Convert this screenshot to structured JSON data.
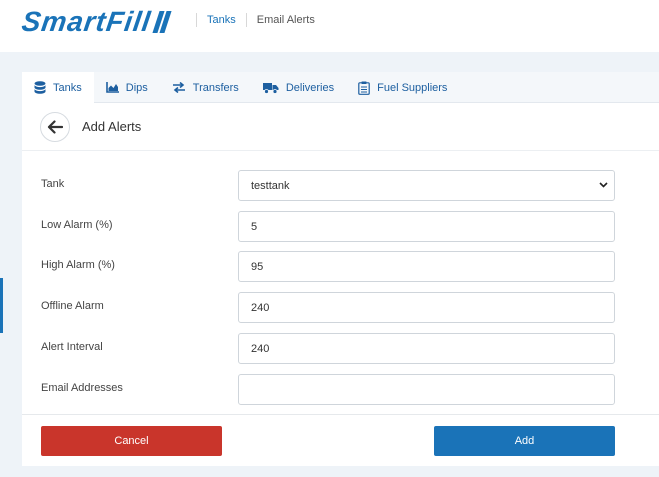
{
  "brand": {
    "name": "SmartFill",
    "color": "#1a73b8"
  },
  "breadcrumb": {
    "link": "Tanks",
    "current": "Email Alerts"
  },
  "tabs": [
    {
      "label": "Tanks",
      "icon": "database-icon",
      "active": true
    },
    {
      "label": "Dips",
      "icon": "area-chart-icon",
      "active": false
    },
    {
      "label": "Transfers",
      "icon": "transfer-arrows-icon",
      "active": false
    },
    {
      "label": "Deliveries",
      "icon": "truck-icon",
      "active": false
    },
    {
      "label": "Fuel Suppliers",
      "icon": "clipboard-list-icon",
      "active": false
    }
  ],
  "page": {
    "title": "Add Alerts",
    "back_icon": "arrow-left-icon"
  },
  "form": {
    "tank": {
      "label": "Tank",
      "value": "testtank"
    },
    "low_alarm": {
      "label": "Low Alarm (%)",
      "value": "5"
    },
    "high_alarm": {
      "label": "High Alarm (%)",
      "value": "95"
    },
    "offline_alarm": {
      "label": "Offline Alarm",
      "value": "240"
    },
    "alert_interval": {
      "label": "Alert Interval",
      "value": "240"
    },
    "email_addresses": {
      "label": "Email Addresses",
      "value": ""
    }
  },
  "buttons": {
    "cancel": {
      "label": "Cancel",
      "color": "#c9352b"
    },
    "add": {
      "label": "Add",
      "color": "#1a73b8"
    }
  }
}
